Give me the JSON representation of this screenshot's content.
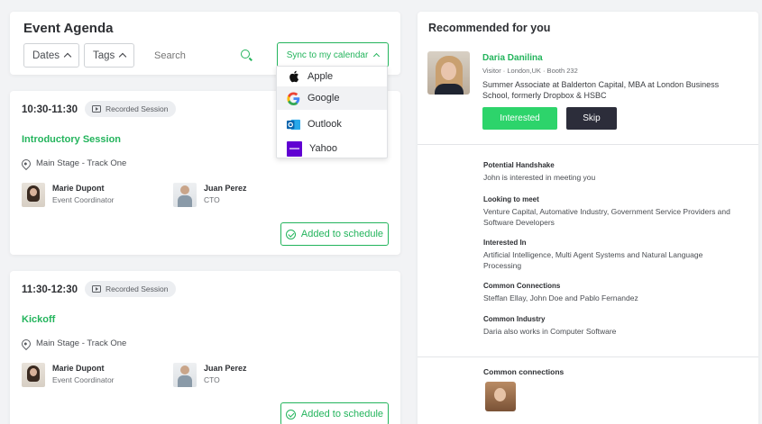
{
  "agenda": {
    "title": "Event Agenda",
    "filters": {
      "dates_label": "Dates",
      "tags_label": "Tags"
    },
    "search": {
      "placeholder": "Search"
    },
    "sync_label": "Sync to my calendar",
    "calendar_options": [
      {
        "label": "Apple",
        "icon": "apple-icon"
      },
      {
        "label": "Google",
        "icon": "google-icon"
      },
      {
        "label": "Outlook",
        "icon": "outlook-icon"
      },
      {
        "label": "Yahoo",
        "icon": "yahoo-icon"
      }
    ]
  },
  "sessions": [
    {
      "time": "10:30-11:30",
      "badge": "Recorded Session",
      "title": "Introductory Session",
      "location": "Main Stage  -  Track One",
      "speakers": [
        {
          "name": "Marie Dupont",
          "role": "Event Coordinator"
        },
        {
          "name": "Juan Perez",
          "role": "CTO"
        }
      ],
      "action_label": "Added to schedule"
    },
    {
      "time": "11:30-12:30",
      "badge": "Recorded Session",
      "title": "Kickoff",
      "location": "Main Stage  -  Track One",
      "speakers": [
        {
          "name": "Marie Dupont",
          "role": "Event Coordinator"
        },
        {
          "name": "Juan Perez",
          "role": "CTO"
        }
      ],
      "action_label": "Added to schedule"
    }
  ],
  "recommended": {
    "title": "Recommended for you",
    "name": "Daria Danilina",
    "meta": "Visitor  ·  London,UK  ·  Booth 232",
    "bio": "Summer Associate at Balderton Capital, MBA at London Business School, formerly Dropbox & HSBC",
    "interested_label": "Interested",
    "skip_label": "Skip",
    "details": [
      {
        "label": "Potential Handshake",
        "value": "John is interested in meeting you"
      },
      {
        "label": "Looking to meet",
        "value": "Venture Capital, Automative Industry, Government Service Providers and Software Developers"
      },
      {
        "label": "Interested In",
        "value": "Artificial Intelligence, Multi Agent Systems and Natural Language Processing"
      },
      {
        "label": "Common Connections",
        "value": "Steffan Ellay, John Doe and Pablo Fernandez"
      },
      {
        "label": "Common Industry",
        "value": "Daria also works in Computer Software"
      }
    ],
    "common_connections_label": "Common connections"
  },
  "colors": {
    "accent": "#23b45c",
    "interested": "#2dd46b",
    "skip": "#2c2d3a"
  }
}
